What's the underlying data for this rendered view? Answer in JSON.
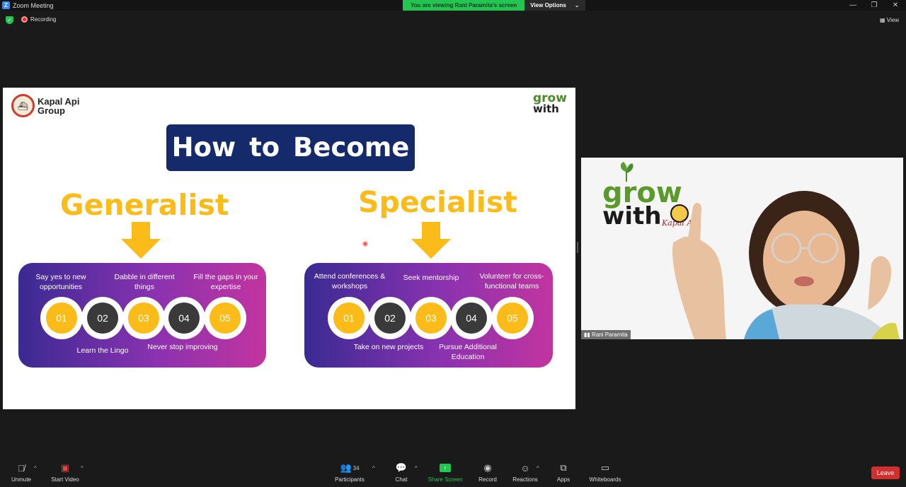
{
  "window": {
    "title": "Zoom Meeting",
    "banner_viewing": "You are viewing Rani Paramita's screen",
    "banner_options": "View Options",
    "controls": [
      "—",
      "❐",
      "✕"
    ]
  },
  "status": {
    "recording_label": "Recording",
    "view_label": "View"
  },
  "slide": {
    "company_line1": "Kapal Api",
    "company_line2": "Group",
    "grow_logo_line1": "grow",
    "grow_logo_line2": "with",
    "headline": "How to Become",
    "left_title": "Generalist",
    "right_title": "Specialist",
    "generalist": {
      "top_labels": [
        "Say yes to new opportunities",
        "Dabble in different things",
        "Fill the gaps in your expertise"
      ],
      "bottom_labels": [
        "Learn the Lingo",
        "Never stop improving"
      ],
      "steps": [
        "01",
        "02",
        "03",
        "04",
        "05"
      ]
    },
    "specialist": {
      "top_labels": [
        "Attend conferences & workshops",
        "Seek mentorship",
        "Volunteer for cross-functional teams"
      ],
      "bottom_labels": [
        "Take on new projects",
        "Pursue Additional Education"
      ],
      "steps": [
        "01",
        "02",
        "03",
        "04",
        "05"
      ]
    }
  },
  "video": {
    "participant_name": "Rani Paramita",
    "logo_line1": "grow",
    "logo_line2": "with",
    "logo_signature": "Kapal Api"
  },
  "toolbar": {
    "unmute": "Unmute",
    "start_video": "Start Video",
    "participants": "Participants",
    "participants_count": "34",
    "chat": "Chat",
    "share_screen": "Share Screen",
    "record": "Record",
    "reactions": "Reactions",
    "apps": "Apps",
    "whiteboards": "Whiteboards",
    "leave": "Leave"
  },
  "colors": {
    "share_green": "#23c552",
    "leave_red": "#d12e2e",
    "slide_navy": "#142a6a",
    "slide_yellow": "#fbbc1a"
  }
}
